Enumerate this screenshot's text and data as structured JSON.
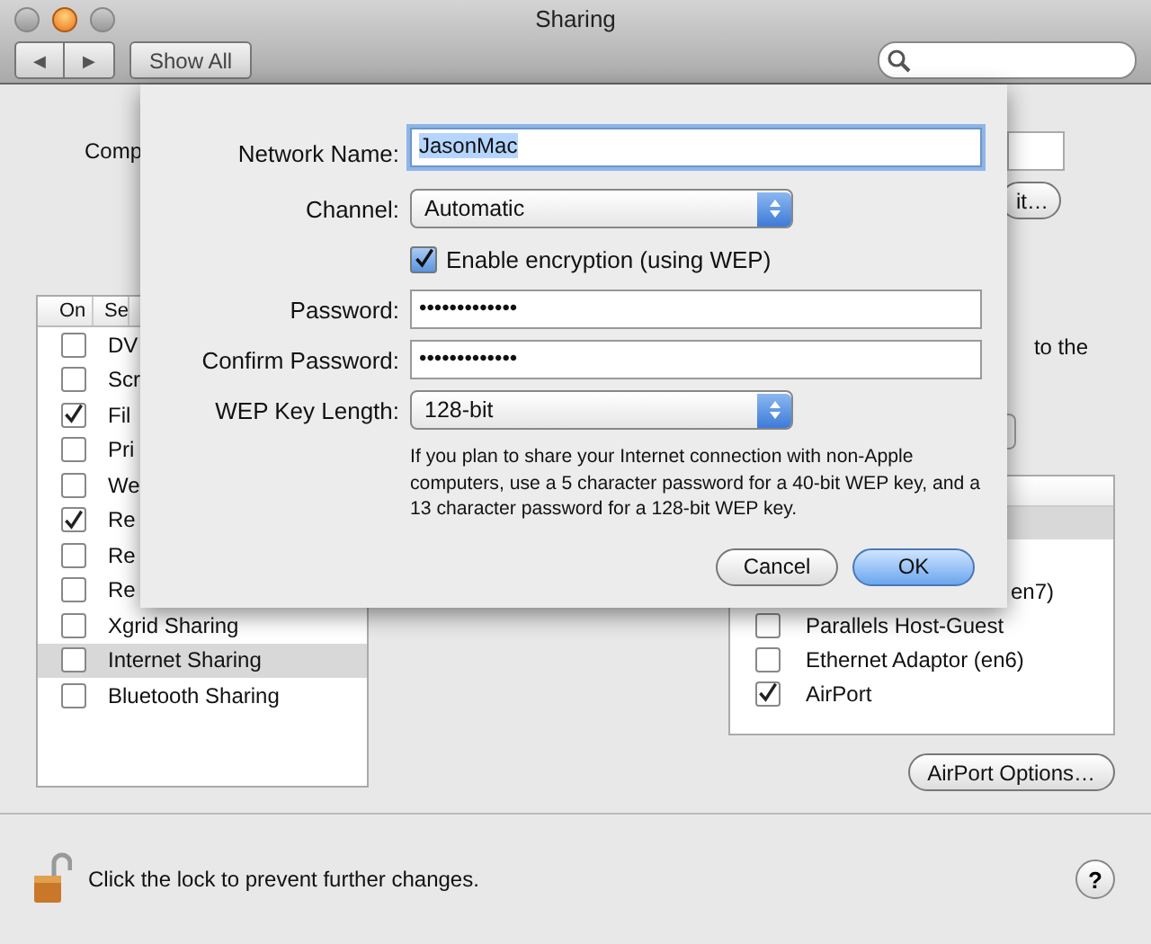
{
  "window": {
    "title": "Sharing"
  },
  "toolbar": {
    "nav_back": "◀",
    "nav_forward": "▶",
    "show_all": "Show All"
  },
  "background": {
    "computer_name_label": "Comp",
    "edit_button": "it…",
    "description_tail": "to the",
    "services": {
      "columns": [
        "On",
        "Se"
      ],
      "rows": [
        {
          "name": "DV",
          "checked": false,
          "selected": false
        },
        {
          "name": "Scr",
          "checked": false,
          "selected": false
        },
        {
          "name": "Fil",
          "checked": true,
          "selected": false
        },
        {
          "name": "Pri",
          "checked": false,
          "selected": false
        },
        {
          "name": "We",
          "checked": false,
          "selected": false
        },
        {
          "name": "Re",
          "checked": true,
          "selected": false
        },
        {
          "name": "Re",
          "checked": false,
          "selected": false
        },
        {
          "name": "Re",
          "checked": false,
          "selected": false
        },
        {
          "name": "Xgrid Sharing",
          "checked": false,
          "selected": false
        },
        {
          "name": "Internet Sharing",
          "checked": false,
          "selected": true
        },
        {
          "name": "Bluetooth Sharing",
          "checked": false,
          "selected": false
        }
      ]
    },
    "ports": [
      {
        "kind": "partial",
        "name": "en7)"
      },
      {
        "kind": "row",
        "name": "Parallels Host-Guest",
        "checked": false
      },
      {
        "kind": "row",
        "name": "Ethernet Adaptor (en6)",
        "checked": false
      },
      {
        "kind": "row",
        "name": "AirPort",
        "checked": true
      }
    ],
    "airport_options": "AirPort Options…"
  },
  "sheet": {
    "network_name_label": "Network Name:",
    "network_name": "JasonMac",
    "channel_label": "Channel:",
    "channel": "Automatic",
    "encryption": {
      "label": "Enable encryption (using WEP)",
      "checked": true
    },
    "password_label": "Password:",
    "password": "•••••••••••••",
    "confirm_label": "Confirm Password:",
    "confirm": "•••••••••••••",
    "key_length_label": "WEP Key Length:",
    "key_length": "128-bit",
    "note": "If you plan to share your Internet connection with non-Apple computers, use a 5 character password for a 40-bit WEP key, and a 13 character password for a 128-bit WEP key.",
    "buttons": [
      {
        "label": "Cancel",
        "default": false
      },
      {
        "label": "OK",
        "default": true
      }
    ]
  },
  "footer": {
    "lock_text": "Click the lock to prevent further changes.",
    "help": "?"
  }
}
